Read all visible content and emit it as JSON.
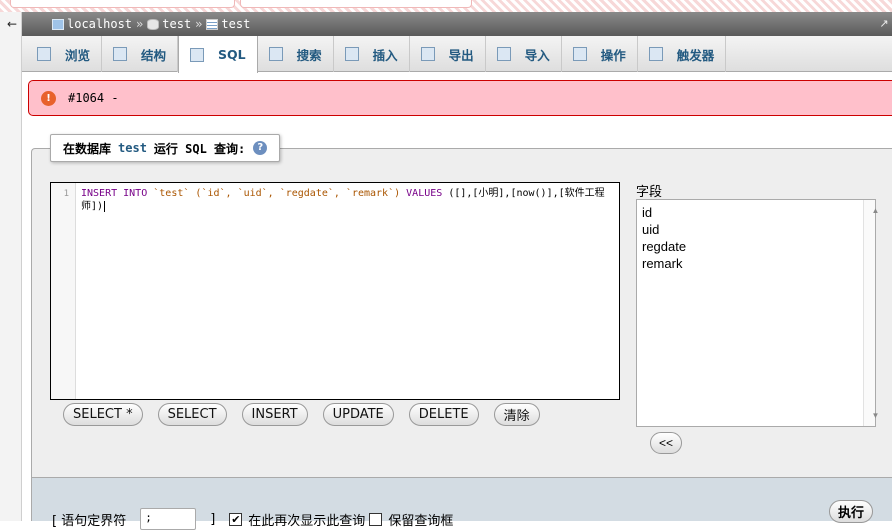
{
  "nav": {
    "back": "←",
    "server": "localhost",
    "sep": "»",
    "database": "test",
    "table": "test"
  },
  "tabs": [
    {
      "label": "浏览",
      "icon": "browse-icon"
    },
    {
      "label": "结构",
      "icon": "structure-icon"
    },
    {
      "label": "SQL",
      "icon": "sql-icon",
      "active": true
    },
    {
      "label": "搜索",
      "icon": "search-icon"
    },
    {
      "label": "插入",
      "icon": "insert-icon"
    },
    {
      "label": "导出",
      "icon": "export-icon"
    },
    {
      "label": "导入",
      "icon": "import-icon"
    },
    {
      "label": "操作",
      "icon": "wrench-icon"
    },
    {
      "label": "触发器",
      "icon": "trigger-icon"
    }
  ],
  "error": {
    "text": "#1064 -"
  },
  "query": {
    "prefix": "在数据库",
    "database": "test",
    "suffix": "运行 SQL 查询:"
  },
  "editor": {
    "line": "1",
    "keyword_insert": "INSERT INTO",
    "table": "`test`",
    "cols": "(`id`, `uid`, `regdate`, `remark`)",
    "keyword_values": "VALUES",
    "values": "([],[小明],[now()],[软件工程师])"
  },
  "buttons": {
    "select_star": "SELECT *",
    "select": "SELECT",
    "insert": "INSERT",
    "update": "UPDATE",
    "delete": "DELETE",
    "clear": "清除"
  },
  "fields": {
    "label": "字段",
    "items": [
      "id",
      "uid",
      "regdate",
      "remark"
    ],
    "insert_button": "<<"
  },
  "bottom": {
    "delimiter_label": "[ 语句定界符",
    "delimiter_value": ";",
    "delimiter_close": "]",
    "show_again": "在此再次显示此查询",
    "keep_box": "保留查询框",
    "execute": "执行"
  },
  "colors": {
    "error_bg": "#ffc0cb",
    "tab_text": "#235a81",
    "nav_bg": "#6b6b6b"
  }
}
